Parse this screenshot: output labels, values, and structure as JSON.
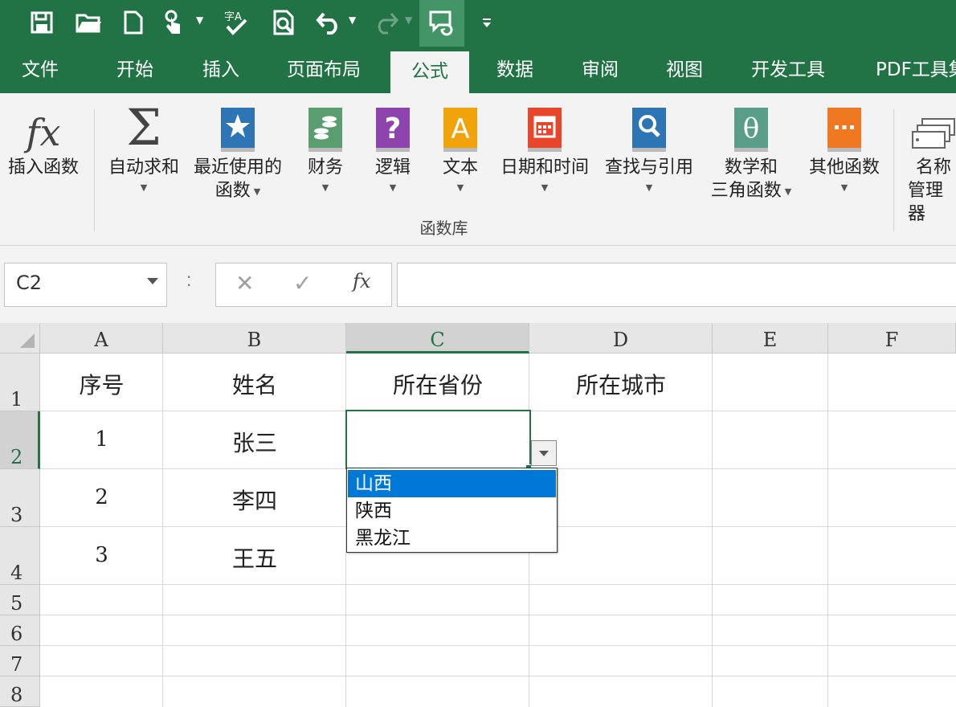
{
  "qat": {
    "items": [
      {
        "name": "save-icon"
      },
      {
        "name": "open-folder-icon"
      },
      {
        "name": "new-file-icon"
      },
      {
        "name": "touch-mode-icon"
      },
      {
        "name": "spelling-icon"
      },
      {
        "name": "print-preview-icon"
      },
      {
        "name": "undo-icon"
      },
      {
        "name": "redo-icon"
      },
      {
        "name": "track-changes-icon"
      },
      {
        "name": "customize-qat-icon"
      }
    ]
  },
  "tabs": [
    {
      "label": "文件"
    },
    {
      "label": "开始"
    },
    {
      "label": "插入"
    },
    {
      "label": "页面布局"
    },
    {
      "label": "公式"
    },
    {
      "label": "数据"
    },
    {
      "label": "审阅"
    },
    {
      "label": "视图"
    },
    {
      "label": "开发工具"
    },
    {
      "label": "PDF工具集"
    }
  ],
  "ribbon": {
    "insert_function": {
      "label": "插入函数",
      "icon": "fx-icon"
    },
    "autosum": {
      "label": "自动求和",
      "icon": "sigma-icon"
    },
    "recent": {
      "line1": "最近使用的",
      "line2": "函数",
      "icon": "star-book-icon",
      "color": "#2e75b6"
    },
    "financial": {
      "label": "财务",
      "icon": "coins-book-icon",
      "color": "#5a9e6f"
    },
    "logical": {
      "label": "逻辑",
      "icon": "question-book-icon",
      "color": "#8e44ad"
    },
    "text": {
      "label": "文本",
      "icon": "text-book-icon",
      "color": "#f0a30a"
    },
    "datetime": {
      "label": "日期和时间",
      "icon": "calendar-book-icon",
      "color": "#e8452a"
    },
    "lookup": {
      "label": "查找与引用",
      "icon": "magnifier-book-icon",
      "color": "#2e75b6"
    },
    "math": {
      "line1": "数学和",
      "line2": "三角函数",
      "icon": "theta-book-icon",
      "color": "#5a9e8a"
    },
    "more": {
      "label": "其他函数",
      "icon": "ellipsis-book-icon",
      "color": "#f07820"
    },
    "name_manager": {
      "line1": "名称",
      "line2": "管理器",
      "icon": "name-tags-icon"
    },
    "group_label": "函数库"
  },
  "formula_bar": {
    "name_box": "C2",
    "formula": ""
  },
  "columns": [
    "A",
    "B",
    "C",
    "D",
    "E",
    "F"
  ],
  "rows": [
    "1",
    "2",
    "3",
    "4",
    "5",
    "6",
    "7",
    "8"
  ],
  "cells": {
    "A1": "序号",
    "B1": "姓名",
    "C1": "所在省份",
    "D1": "所在城市",
    "A2": "1",
    "B2": "张三",
    "A3": "2",
    "B3": "李四",
    "A4": "3",
    "B4": "王五"
  },
  "dropdown": {
    "options": [
      "山西",
      "陕西",
      "黑龙江"
    ],
    "highlighted": "山西"
  },
  "colors": {
    "accent": "#217346",
    "selection": "#0078d7"
  }
}
